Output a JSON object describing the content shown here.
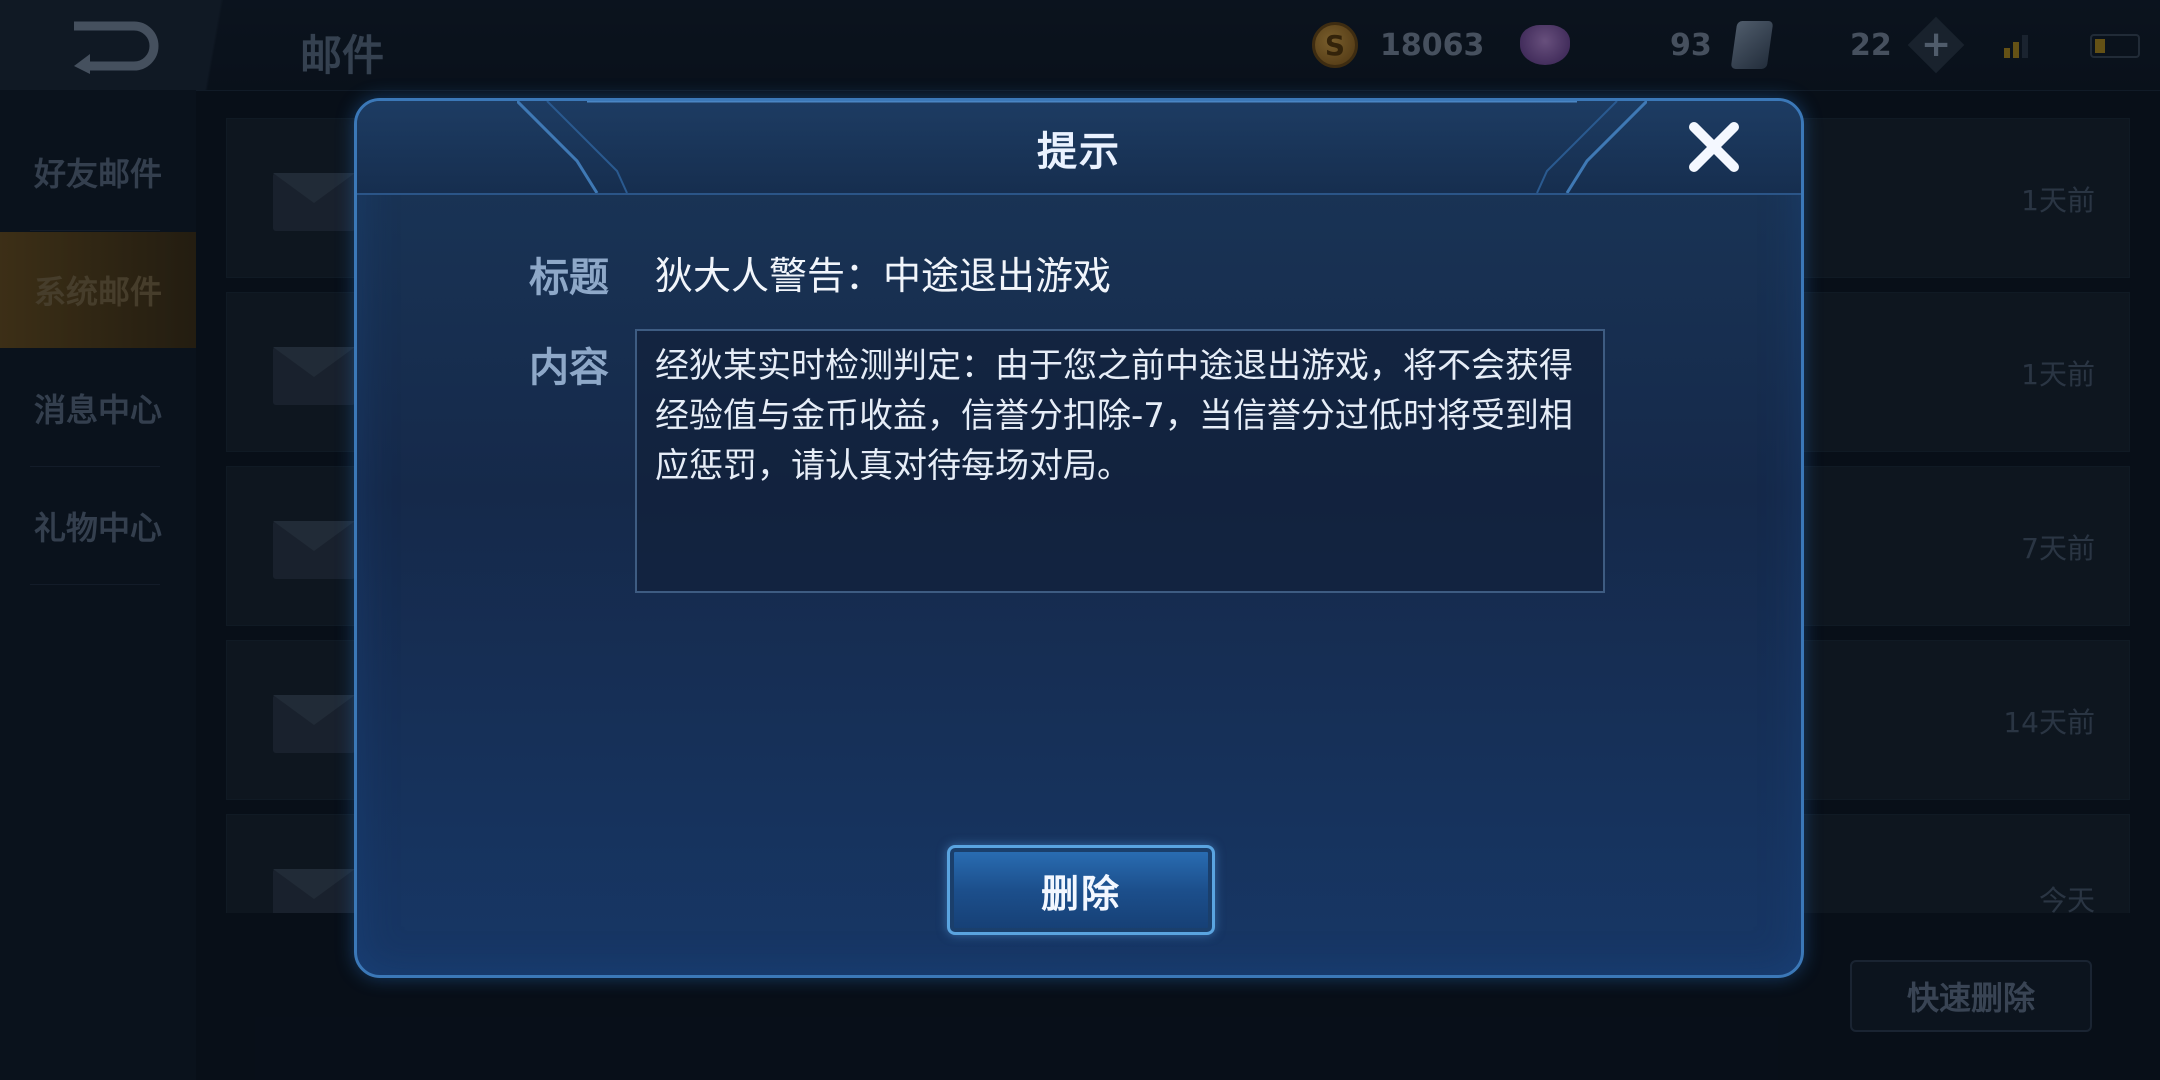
{
  "header": {
    "title": "邮件",
    "resources": {
      "gold": "18063",
      "diamond": "93",
      "cards": "22"
    }
  },
  "sidebar": {
    "items": [
      {
        "label": "好友邮件"
      },
      {
        "label": "系统邮件"
      },
      {
        "label": "消息中心"
      },
      {
        "label": "礼物中心"
      }
    ]
  },
  "mail_list": {
    "rows": [
      {
        "time": "1天前"
      },
      {
        "time": "1天前"
      },
      {
        "time": "7天前"
      },
      {
        "time": "14天前"
      },
      {
        "time": "今天"
      }
    ]
  },
  "quick_delete_label": "快速删除",
  "dialog": {
    "title": "提示",
    "subject_label": "标题",
    "subject": "狄大人警告：中途退出游戏",
    "content_label": "内容",
    "content": "经狄某实时检测判定：由于您之前中途退出游戏，将不会获得经验值与金币收益，信誉分扣除-7，当信誉分过低时将受到相应惩罚，请认真对待每场对局。",
    "delete_label": "删除"
  }
}
